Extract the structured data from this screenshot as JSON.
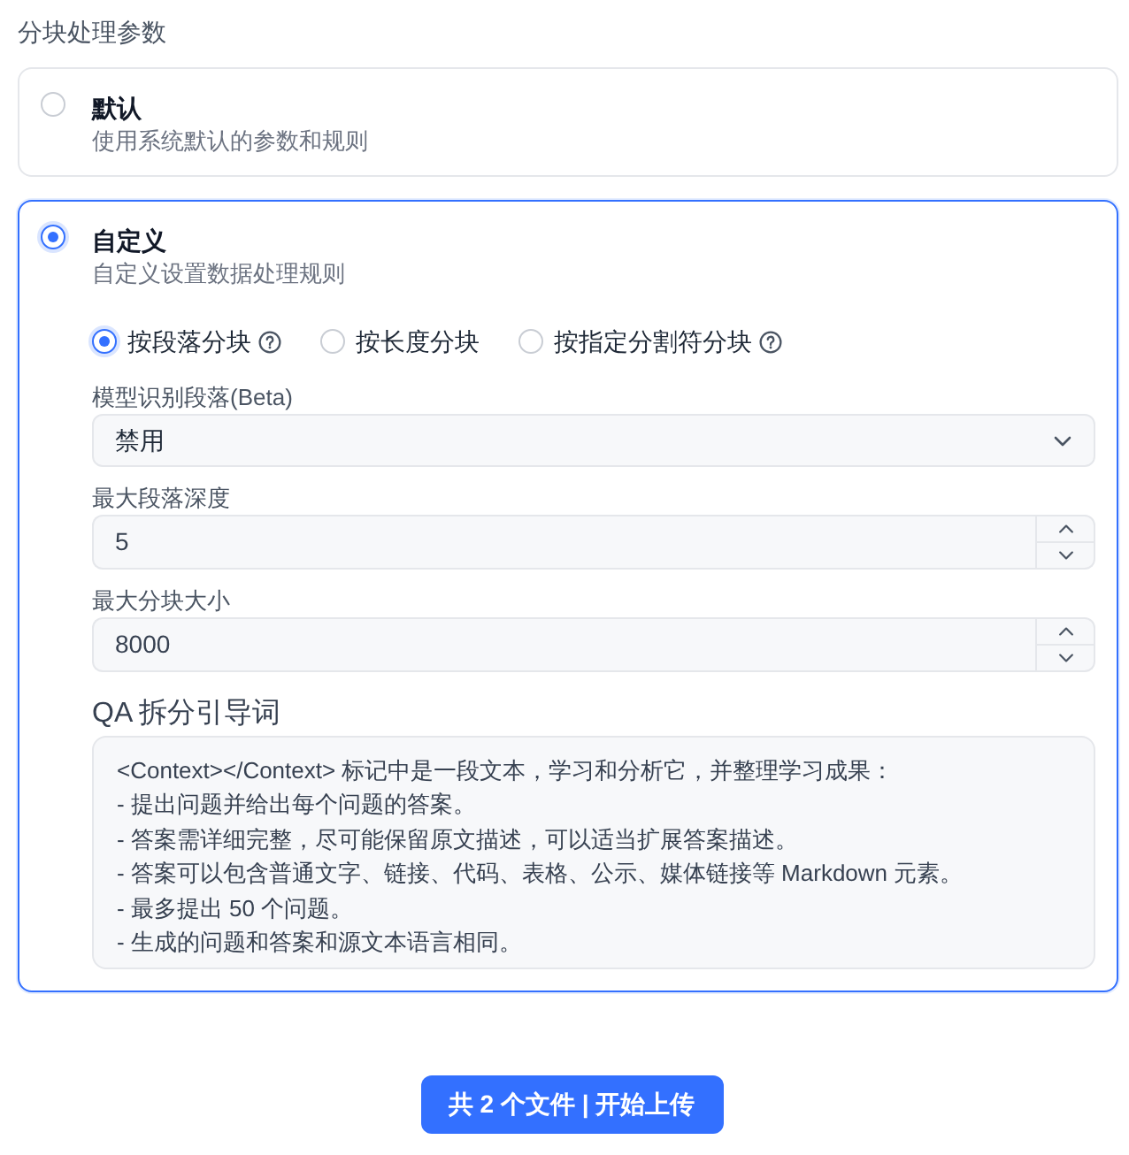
{
  "section_title": "分块处理参数",
  "modes": [
    {
      "title": "默认",
      "description": "使用系统默认的参数和规则",
      "selected": false
    },
    {
      "title": "自定义",
      "description": "自定义设置数据处理规则",
      "selected": true,
      "settings": {
        "chunk_methods": [
          {
            "label": "按段落分块",
            "selected": true,
            "help": true
          },
          {
            "label": "按长度分块",
            "selected": false,
            "help": false
          },
          {
            "label": "按指定分割符分块",
            "selected": false,
            "help": true
          }
        ],
        "fields": [
          {
            "kind": "select",
            "label": "模型识别段落(Beta)",
            "value": "禁用"
          },
          {
            "kind": "number",
            "label": "最大段落深度",
            "value": "5"
          },
          {
            "kind": "number",
            "label": "最大分块大小",
            "value": "8000"
          }
        ],
        "qa_prompt": {
          "label": "QA 拆分引导词",
          "value": "<Context></Context> 标记中是一段文本，学习和分析它，并整理学习成果：\n- 提出问题并给出每个问题的答案。\n- 答案需详细完整，尽可能保留原文描述，可以适当扩展答案描述。\n- 答案可以包含普通文字、链接、代码、表格、公示、媒体链接等 Markdown 元素。\n- 最多提出 50 个问题。\n- 生成的问题和答案和源文本语言相同。"
        }
      }
    }
  ],
  "submit_button": {
    "label": "共 2 个文件 | 开始上传"
  }
}
